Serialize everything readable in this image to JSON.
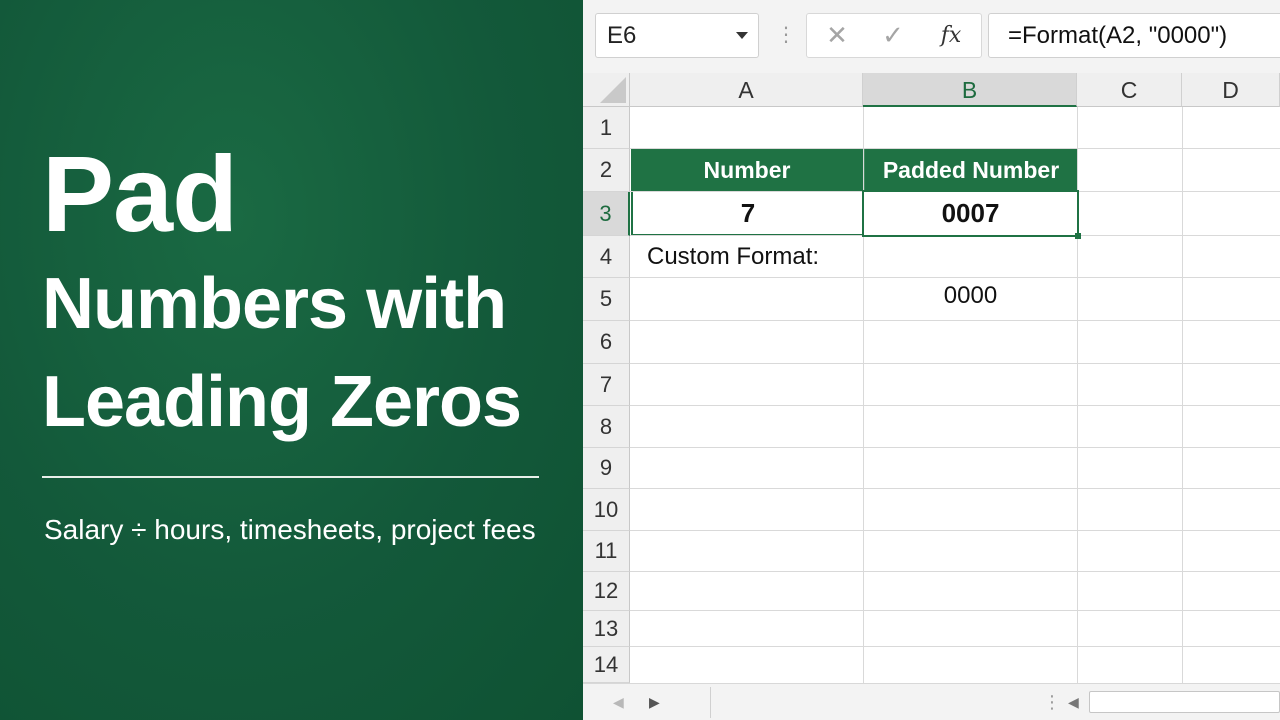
{
  "banner": {
    "title_line1": "Pad",
    "title_line2": "Numbers with",
    "title_line3": "Leading Zeros",
    "subtitle": "Salary ÷ hours, timesheets, project fees"
  },
  "formula_bar": {
    "name_box": "E6",
    "cancel_icon": "✕",
    "enter_icon": "✓",
    "function_icon": "fx",
    "formula": "=Format(A2, \"0000\")"
  },
  "sheet": {
    "columns": [
      "A",
      "B",
      "C",
      "D"
    ],
    "selected_column": "B",
    "rows": [
      "1",
      "2",
      "3",
      "4",
      "5",
      "6",
      "7",
      "8",
      "9",
      "10",
      "11",
      "12",
      "13",
      "14"
    ],
    "selected_row": "3",
    "cells": {
      "A2": "Number",
      "B2": "Padded Number",
      "A3": "7",
      "B3": "0007",
      "A4": "Custom Format:",
      "B5": "0000"
    }
  },
  "scrollbar": {
    "prev_icon": "◀",
    "next_icon": "▶",
    "more_icon": "⋮",
    "scroll_left_icon": "◀"
  },
  "colors": {
    "brand_green": "#14603b",
    "header_fill": "#1f7244"
  }
}
